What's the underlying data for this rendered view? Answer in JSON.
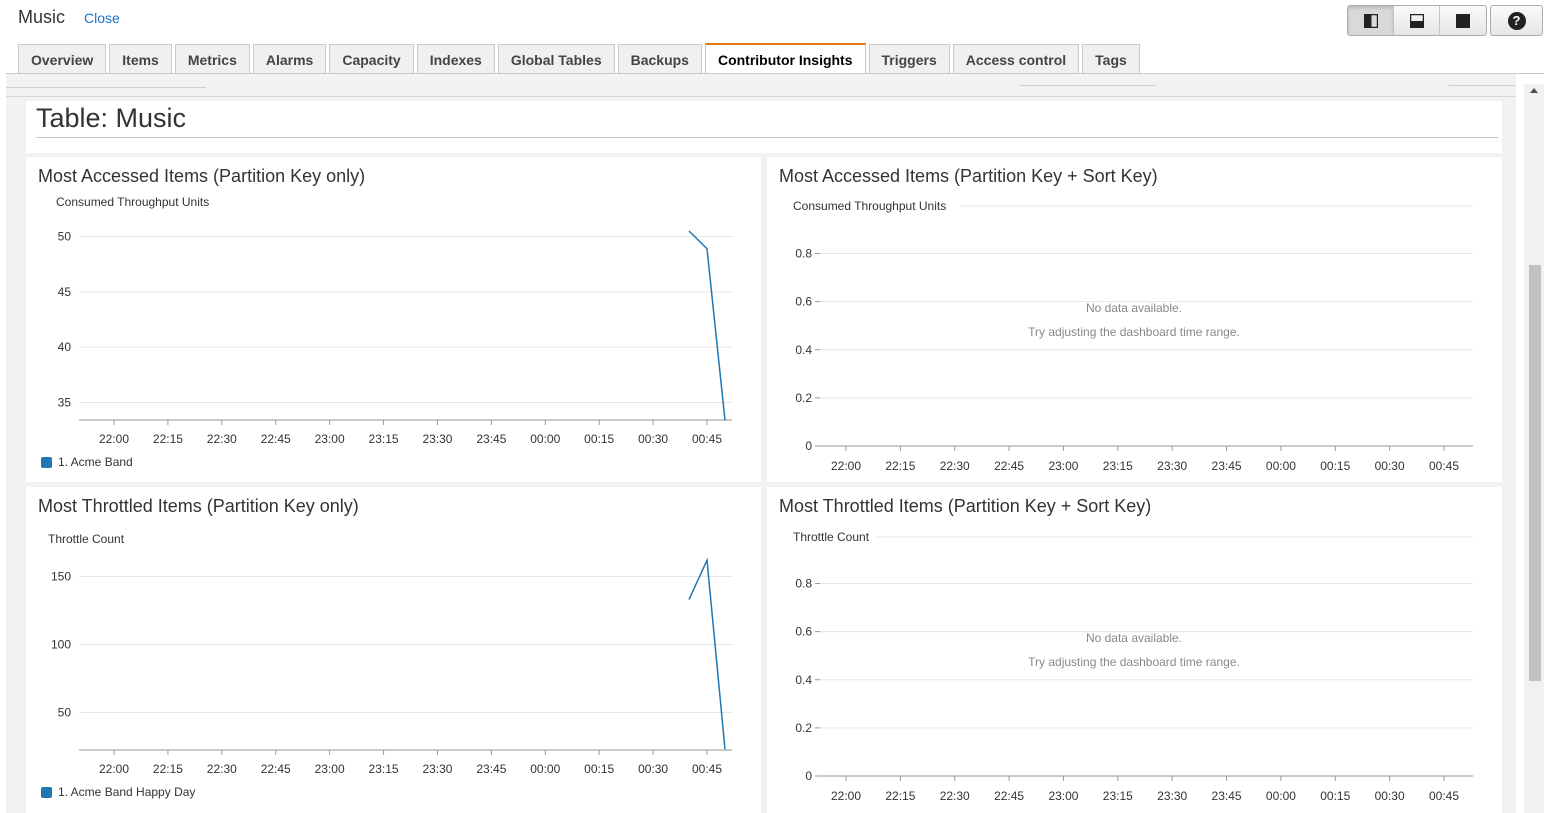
{
  "app": {
    "title": "Music",
    "close_label": "Close"
  },
  "view_buttons": [
    {
      "icon": "split-vertical-icon"
    },
    {
      "icon": "split-horizontal-icon"
    },
    {
      "icon": "full-view-icon"
    }
  ],
  "help": {
    "icon": "help-icon",
    "glyph": "?"
  },
  "tabs": [
    "Overview",
    "Items",
    "Metrics",
    "Alarms",
    "Capacity",
    "Indexes",
    "Global Tables",
    "Backups",
    "Contributor Insights",
    "Triggers",
    "Access control",
    "Tags"
  ],
  "active_tab": "Contributor Insights",
  "table_title": "Table: Music",
  "colors": {
    "series": "#1f77b4",
    "accent_tab": "#e47911",
    "link": "#1a73c4"
  },
  "panels": {
    "p1": {
      "title": "Most Accessed Items (Partition Key only)"
    },
    "p2": {
      "title": "Most Accessed Items (Partition Key + Sort Key)",
      "no_data": "No data available.",
      "no_data_hint": "Try adjusting the dashboard time range."
    },
    "p3": {
      "title": "Most Throttled Items (Partition Key only)"
    },
    "p4": {
      "title": "Most Throttled Items (Partition Key + Sort Key)",
      "no_data": "No data available.",
      "no_data_hint": "Try adjusting the dashboard time range."
    }
  },
  "chart_data": [
    {
      "type": "line",
      "title": "Most Accessed Items (Partition Key only)",
      "ylabel": "Consumed Throughput Units",
      "yticks": [
        35,
        40,
        45,
        50
      ],
      "ylim": [
        33.4,
        51.2
      ],
      "xticks": [
        "22:00",
        "22:15",
        "22:30",
        "22:45",
        "23:00",
        "23:15",
        "23:30",
        "23:45",
        "00:00",
        "00:15",
        "00:30",
        "00:45"
      ],
      "series": [
        {
          "name": "1. Acme Band",
          "x": [
            "00:40",
            "00:45",
            "00:50"
          ],
          "values": [
            50.5,
            48.9,
            33.4
          ]
        }
      ],
      "legend": "bottom-left",
      "grid": true
    },
    {
      "type": "line",
      "title": "Most Accessed Items (Partition Key + Sort Key)",
      "ylabel": "Consumed Throughput Units",
      "yticks": [
        0,
        0.2,
        0.4,
        0.6,
        0.8
      ],
      "ylim": [
        0,
        1
      ],
      "xticks": [
        "22:00",
        "22:15",
        "22:30",
        "22:45",
        "23:00",
        "23:15",
        "23:30",
        "23:45",
        "00:00",
        "00:15",
        "00:30",
        "00:45"
      ],
      "series": [],
      "grid": true
    },
    {
      "type": "line",
      "title": "Most Throttled Items (Partition Key only)",
      "ylabel": "Throttle Count",
      "yticks": [
        50,
        100,
        150
      ],
      "ylim": [
        23,
        170
      ],
      "xticks": [
        "22:00",
        "22:15",
        "22:30",
        "22:45",
        "23:00",
        "23:15",
        "23:30",
        "23:45",
        "00:00",
        "00:15",
        "00:30",
        "00:45"
      ],
      "series": [
        {
          "name": "1. Acme Band Happy Day",
          "x": [
            "00:40",
            "00:45",
            "00:50"
          ],
          "values": [
            133,
            162,
            23
          ]
        }
      ],
      "legend": "bottom-left",
      "grid": true
    },
    {
      "type": "line",
      "title": "Most Throttled Items (Partition Key + Sort Key)",
      "ylabel": "Throttle Count",
      "yticks": [
        0,
        0.2,
        0.4,
        0.6,
        0.8
      ],
      "ylim": [
        0,
        1
      ],
      "xticks": [
        "22:00",
        "22:15",
        "22:30",
        "22:45",
        "23:00",
        "23:15",
        "23:30",
        "23:45",
        "00:00",
        "00:15",
        "00:30",
        "00:45"
      ],
      "series": [],
      "grid": true
    }
  ]
}
